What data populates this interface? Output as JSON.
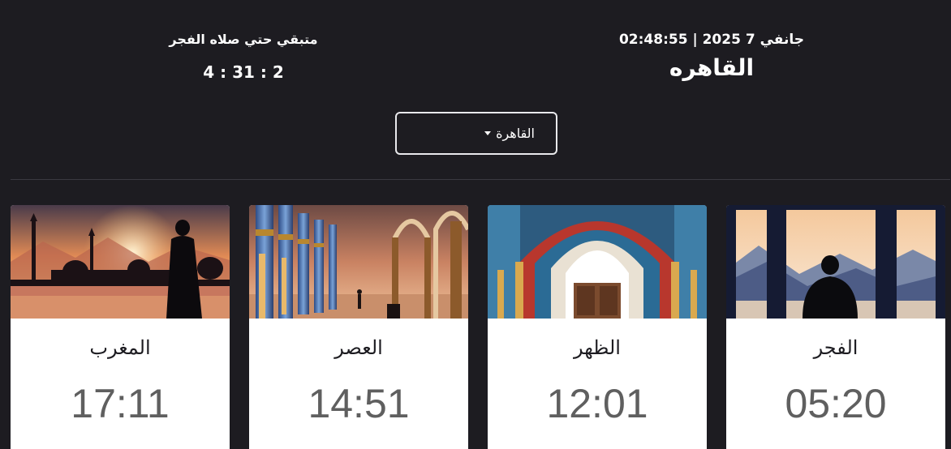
{
  "header": {
    "date_time": "جانفي 7 2025 | 02:48:55",
    "city_title": "القاهره",
    "remaining_label": "متبقي حتي صلاه الفجر",
    "remaining_value": "4 : 31 : 2"
  },
  "city_select": {
    "selected": "القاهرة"
  },
  "prayers": [
    {
      "name": "الفجر",
      "time": "05:20",
      "image": "window-silhouette-mountains"
    },
    {
      "name": "الظهر",
      "time": "12:01",
      "image": "mosque-arch-doorway"
    },
    {
      "name": "العصر",
      "time": "14:51",
      "image": "mosque-colonnade-sunset"
    },
    {
      "name": "المغرب",
      "time": "17:11",
      "image": "mosque-skyline-sunset-silhouette"
    }
  ],
  "colors": {
    "background": "#1d1c21",
    "card": "#ffffff",
    "time_text": "#5f5f5f"
  }
}
